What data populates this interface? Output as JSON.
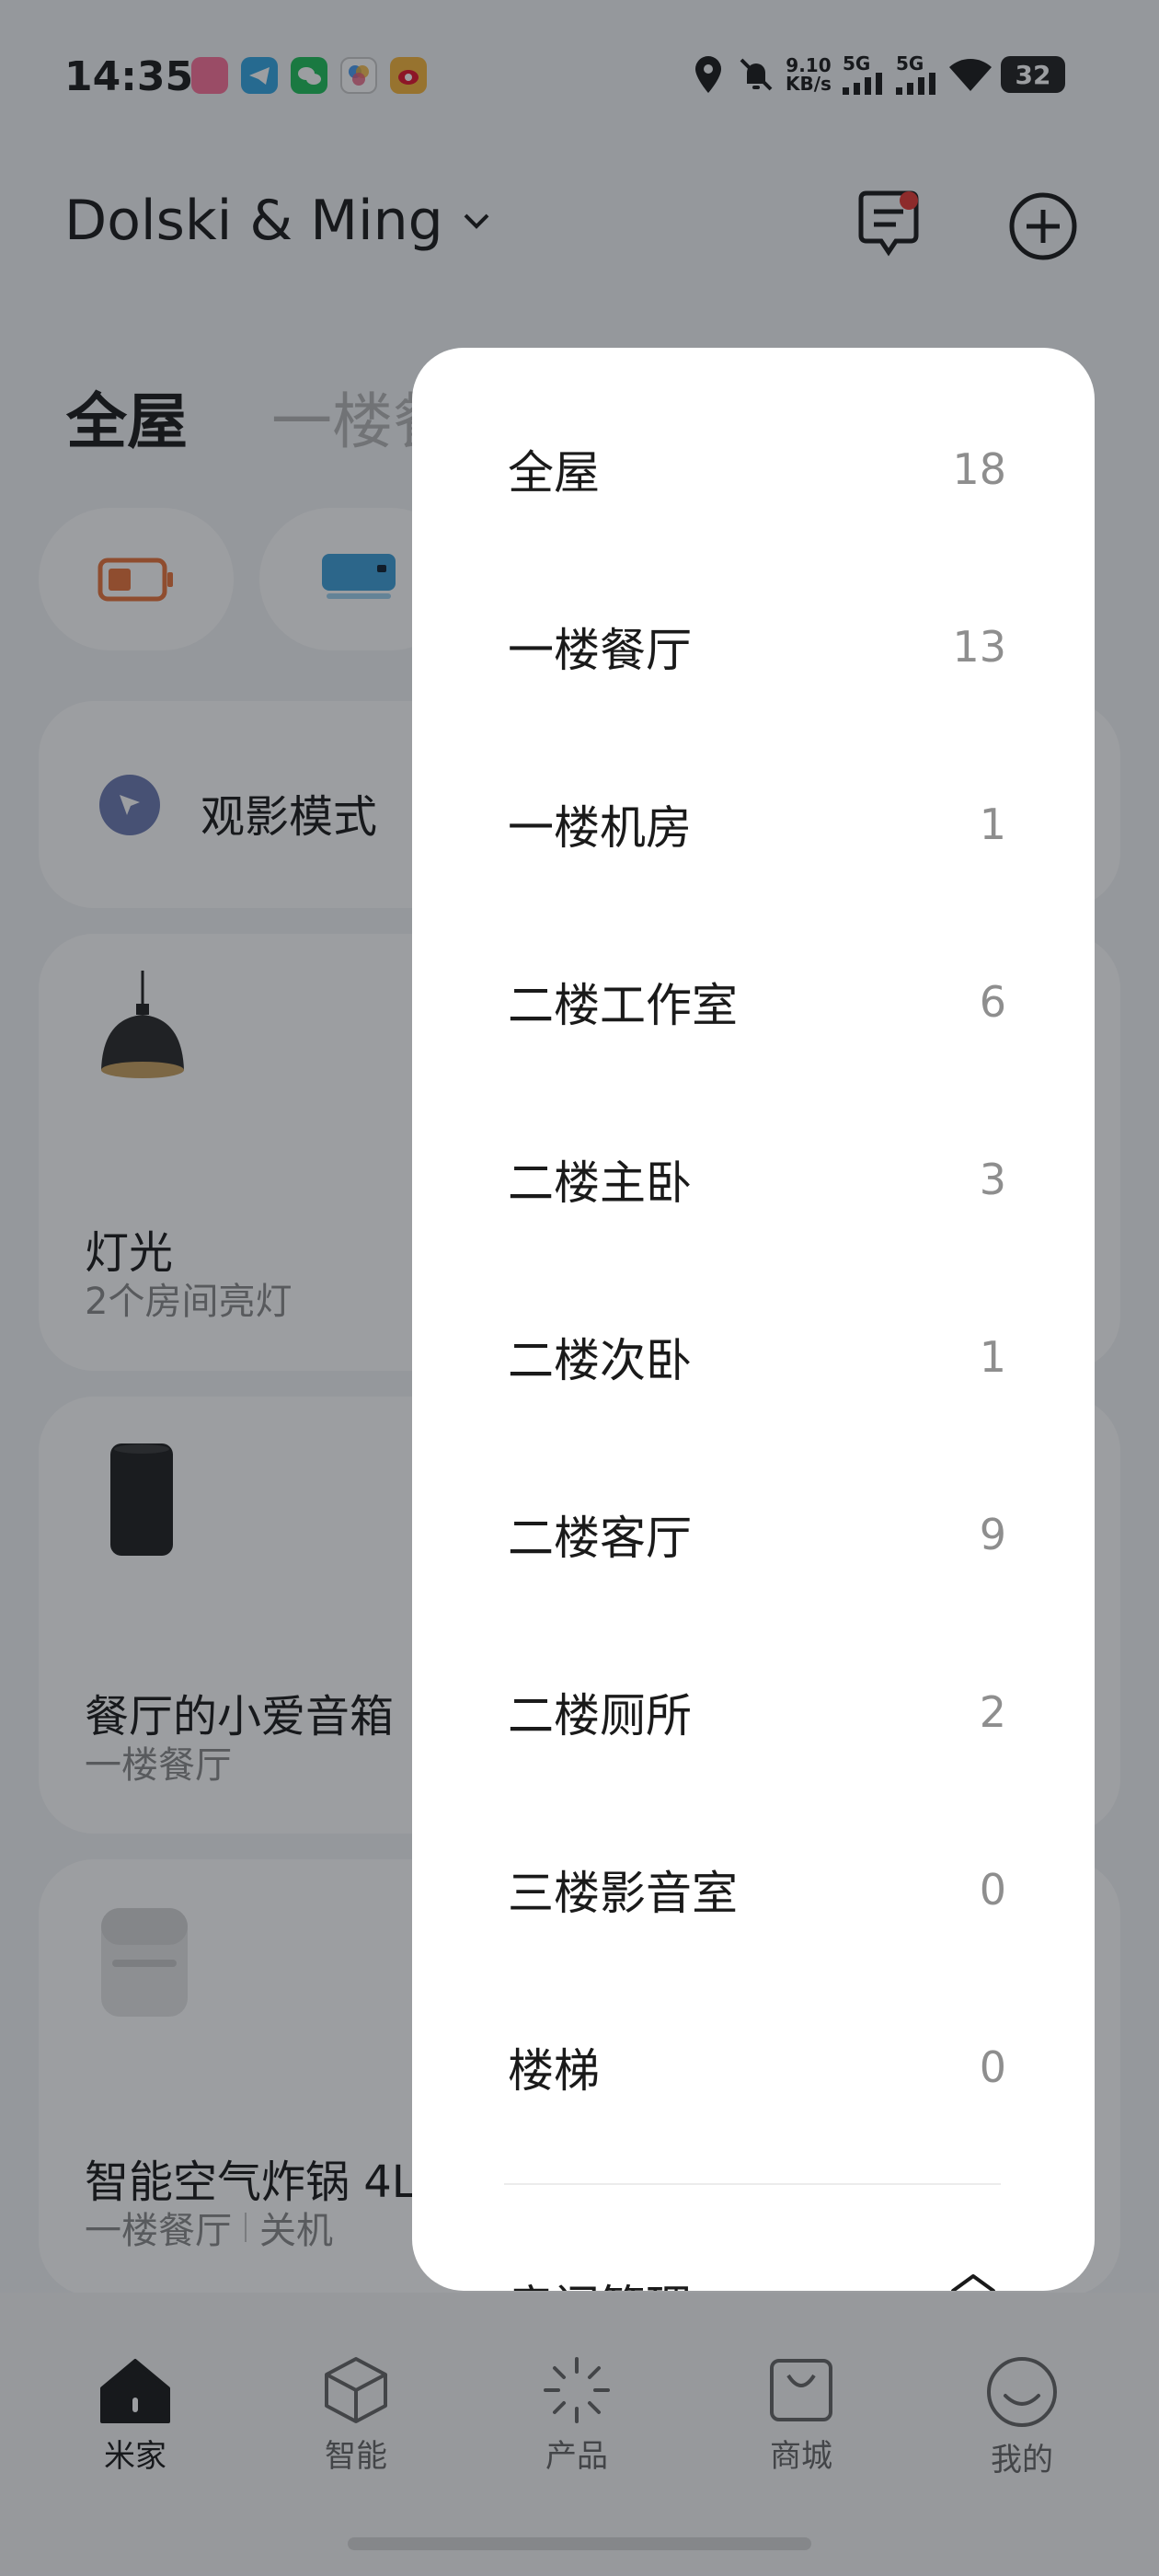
{
  "status_bar": {
    "time": "14:35",
    "net_speed_value": "9.10",
    "net_speed_unit": "KB/s",
    "signal1": "5G",
    "signal2": "5G",
    "battery": "32",
    "app_icons": [
      "bilibili-icon",
      "telegram-icon",
      "wechat-icon",
      "photos-icon",
      "weibo-icon"
    ]
  },
  "header": {
    "home_name": "Dolski & Ming",
    "message_icon": "message-icon",
    "add_icon": "add-icon"
  },
  "tabs": {
    "active": "全屋",
    "next": "一楼餐厅"
  },
  "scene": {
    "label": "观影模式"
  },
  "devices": [
    {
      "name": "灯光",
      "sub": "2个房间亮灯"
    },
    {
      "name": "餐厅的小爱音箱",
      "sub": "一楼餐厅"
    },
    {
      "name": "智能空气炸锅 4L",
      "sub_room": "一楼餐厅",
      "sub_status": "关机"
    }
  ],
  "room_menu": {
    "rooms": [
      {
        "name": "全屋",
        "count": "18"
      },
      {
        "name": "一楼餐厅",
        "count": "13"
      },
      {
        "name": "一楼机房",
        "count": "1"
      },
      {
        "name": "二楼工作室",
        "count": "6"
      },
      {
        "name": "二楼主卧",
        "count": "3"
      },
      {
        "name": "二楼次卧",
        "count": "1"
      },
      {
        "name": "二楼客厅",
        "count": "9"
      },
      {
        "name": "二楼厕所",
        "count": "2"
      },
      {
        "name": "三楼影音室",
        "count": "0"
      },
      {
        "name": "楼梯",
        "count": "0"
      }
    ],
    "manage_label": "房间管理"
  },
  "bottom_nav": [
    {
      "label": "米家",
      "icon": "home-icon",
      "active": true
    },
    {
      "label": "智能",
      "icon": "smart-cube-icon",
      "active": false
    },
    {
      "label": "产品",
      "icon": "products-icon",
      "active": false
    },
    {
      "label": "商城",
      "icon": "shop-bag-icon",
      "active": false
    },
    {
      "label": "我的",
      "icon": "profile-smile-icon",
      "active": false
    }
  ],
  "colors": {
    "accent_dark": "#1a1a1a",
    "notification_dot": "#e53935",
    "battery_chip": "#e8743b",
    "ac_chip": "#3f9fd8",
    "scene_icon": "#6d7ab2"
  }
}
